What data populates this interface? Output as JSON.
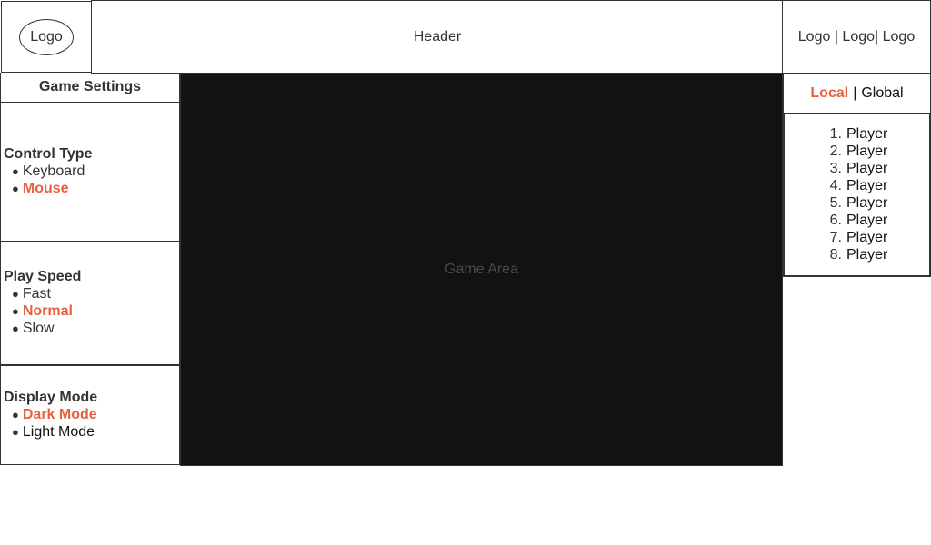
{
  "header": {
    "logo_label": "Logo",
    "title": "Header",
    "right_logos": "Logo | Logo| Logo"
  },
  "settings": {
    "title": "Game Settings",
    "control_type": {
      "heading": "Control Type",
      "options": [
        "Keyboard",
        "Mouse"
      ],
      "selected": "Mouse"
    },
    "play_speed": {
      "heading": "Play Speed",
      "options": [
        "Fast",
        "Normal",
        "Slow"
      ],
      "selected": "Normal"
    },
    "display_mode": {
      "heading": "Display Mode",
      "options": [
        "Dark Mode",
        "Light Mode"
      ],
      "selected": "Dark Mode"
    }
  },
  "game": {
    "label": "Game Area"
  },
  "leaderboard": {
    "scopes": [
      "Local",
      "Global"
    ],
    "active_scope": "Local",
    "separator": "|",
    "ranks": [
      "1.",
      "2.",
      "3.",
      "4.",
      "5.",
      "6.",
      "7.",
      "8."
    ],
    "players": [
      "Player",
      "Player",
      "Player",
      "Player",
      "Player",
      "Player",
      "Player",
      "Player"
    ]
  },
  "colors": {
    "accent": "#e8613f",
    "game_bg": "#121212",
    "border": "#333333"
  },
  "icons": {
    "bullet": "bullet-icon"
  }
}
